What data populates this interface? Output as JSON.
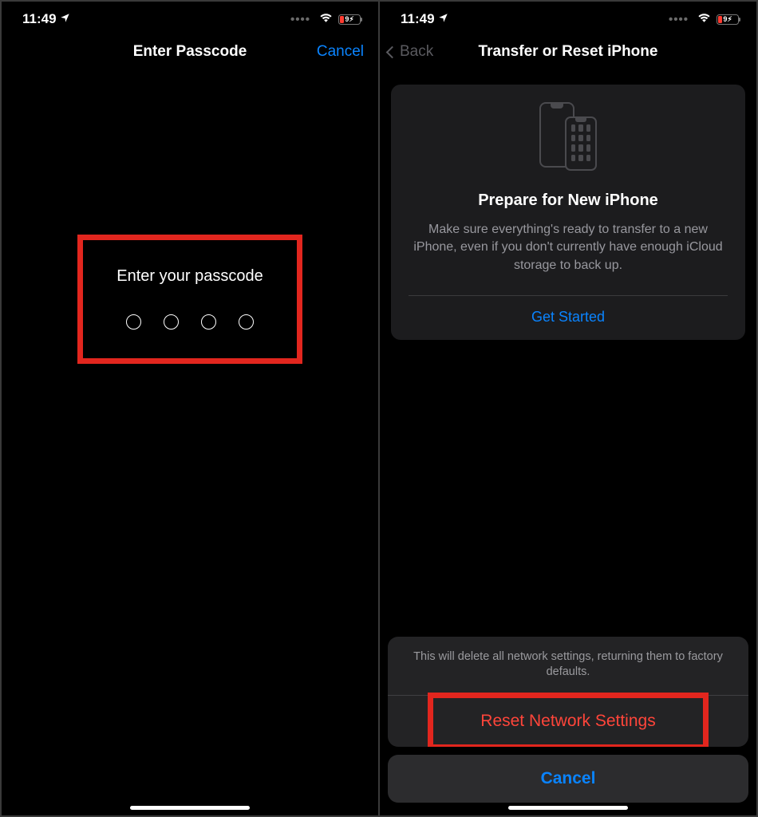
{
  "status": {
    "time": "11:49",
    "battery_text": "9"
  },
  "left": {
    "nav_title": "Enter Passcode",
    "cancel": "Cancel",
    "prompt": "Enter your passcode"
  },
  "right": {
    "back": "Back",
    "nav_title": "Transfer or Reset iPhone",
    "card_title": "Prepare for New iPhone",
    "card_desc": "Make sure everything's ready to transfer to a new iPhone, even if you don't currently have enough iCloud storage to back up.",
    "get_started": "Get Started",
    "sheet_message": "This will delete all network settings, returning them to factory defaults.",
    "sheet_action": "Reset Network Settings",
    "sheet_cancel": "Cancel"
  }
}
